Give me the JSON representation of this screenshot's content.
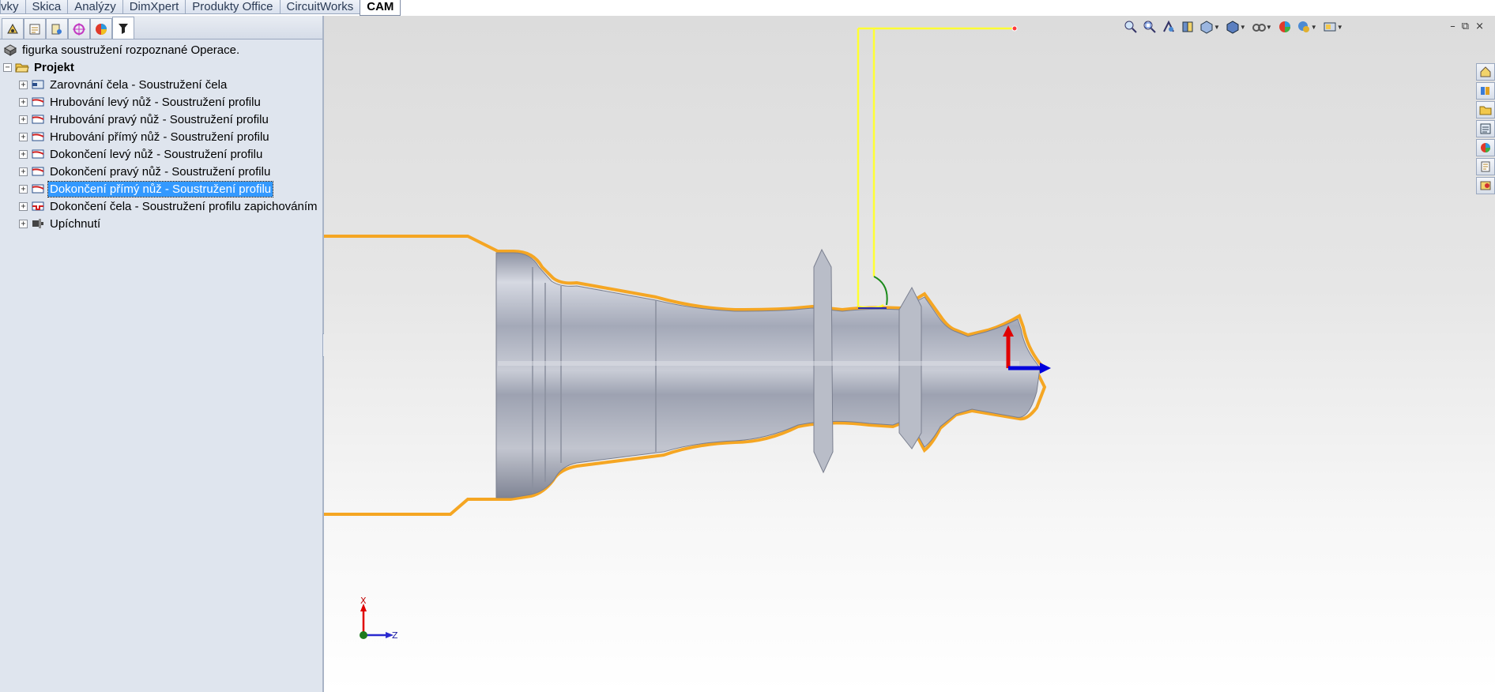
{
  "tabs": [
    {
      "label": "vky",
      "active": false
    },
    {
      "label": "Skica",
      "active": false
    },
    {
      "label": "Analýzy",
      "active": false
    },
    {
      "label": "DimXpert",
      "active": false
    },
    {
      "label": "Produkty Office",
      "active": false
    },
    {
      "label": "CircuitWorks",
      "active": false
    },
    {
      "label": "CAM",
      "active": true
    }
  ],
  "panel_tabs": [
    {
      "icon": "feature-manager-icon"
    },
    {
      "icon": "property-manager-icon"
    },
    {
      "icon": "configuration-manager-icon"
    },
    {
      "icon": "dimxpert-manager-icon"
    },
    {
      "icon": "display-manager-icon"
    },
    {
      "icon": "cam-operation-tree-icon"
    }
  ],
  "tree": {
    "header": "figurka soustružení rozpoznané Operace.",
    "root": "Projekt",
    "items": [
      {
        "label": "Zarovnání čela - Soustružení čela",
        "icon": "face-turn-icon",
        "selected": false
      },
      {
        "label": "Hrubování levý nůž - Soustružení profilu",
        "icon": "profile-turn-icon",
        "selected": false
      },
      {
        "label": "Hrubování pravý nůž - Soustružení profilu",
        "icon": "profile-turn-icon",
        "selected": false
      },
      {
        "label": "Hrubování přímý nůž - Soustružení profilu",
        "icon": "profile-turn-icon",
        "selected": false
      },
      {
        "label": "Dokončení levý nůž - Soustružení profilu",
        "icon": "profile-turn-icon",
        "selected": false
      },
      {
        "label": "Dokončení pravý nůž - Soustružení profilu",
        "icon": "profile-turn-icon",
        "selected": false
      },
      {
        "label": "Dokončení přímý nůž - Soustružení profilu",
        "icon": "profile-turn-icon",
        "selected": true
      },
      {
        "label": "Dokončení čela - Soustružení profilu zapichováním",
        "icon": "groove-turn-icon",
        "selected": false
      },
      {
        "label": "Upíchnutí",
        "icon": "cutoff-icon",
        "selected": false
      }
    ]
  },
  "view_toolbar": [
    "zoom-to-fit-icon",
    "zoom-to-area-icon",
    "previous-view-icon",
    "section-view-icon",
    "view-orientation-icon",
    "display-style-icon",
    "hide-show-items-icon",
    "edit-appearance-icon",
    "apply-scene-icon",
    "view-settings-icon"
  ],
  "window_controls": {
    "minimize": "–",
    "restore": "⧉",
    "close": "×"
  },
  "task_pane": [
    "resources-icon",
    "design-library-icon",
    "file-explorer-icon",
    "view-palette-icon",
    "appearances-icon",
    "custom-properties-icon",
    "cam-library-icon"
  ],
  "triad": {
    "x_label": "X",
    "z_label": "Z"
  },
  "colors": {
    "selection": "#3399ff",
    "stock_outline": "#f5a623",
    "toolpath": "#ffff33",
    "part": "#a8adbd",
    "axis_x": "#e00000",
    "axis_z": "#0000dd"
  }
}
